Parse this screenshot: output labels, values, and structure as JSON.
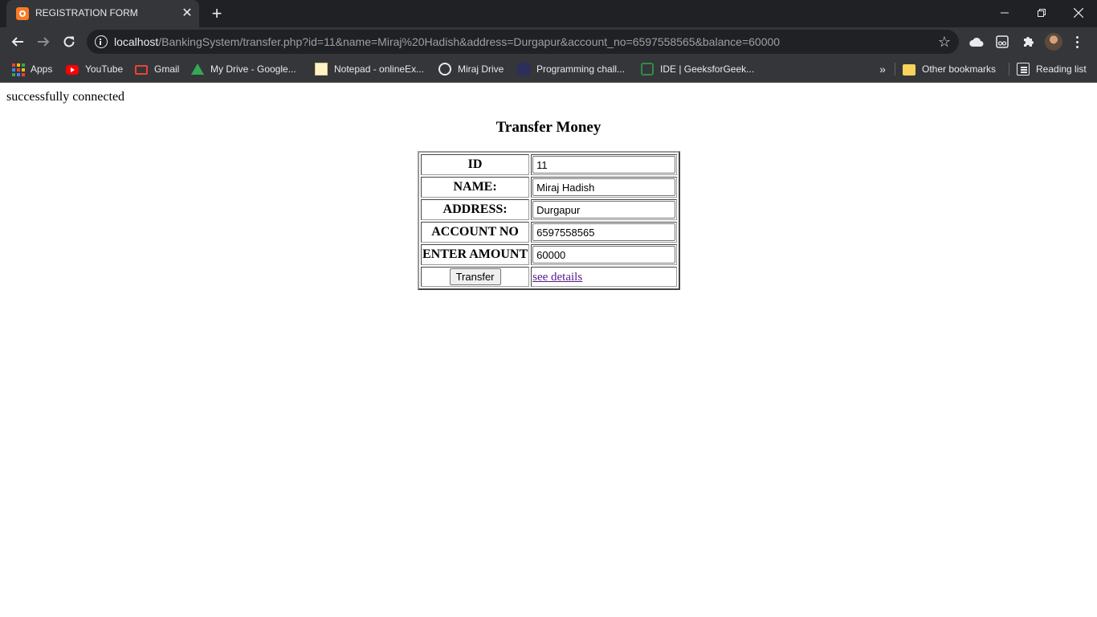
{
  "browser": {
    "tab": {
      "title": "REGISTRATION FORM"
    },
    "address_bar": {
      "host": "localhost",
      "path": "/BankingSystem/transfer.php?id=11&name=Miraj%20Hadish&address=Durgapur&account_no=6597558565&balance=60000"
    },
    "bookmarks": [
      {
        "label": "Apps",
        "icon": "apps-grid-icon"
      },
      {
        "label": "YouTube",
        "icon": "youtube-icon"
      },
      {
        "label": "Gmail",
        "icon": "gmail-icon"
      },
      {
        "label": "My Drive - Google...",
        "icon": "google-drive-icon"
      },
      {
        "label": "Notepad - onlineEx...",
        "icon": "notepad-icon"
      },
      {
        "label": "Miraj Drive",
        "icon": "globe-icon"
      },
      {
        "label": "Programming chall...",
        "icon": "bookmark-site-icon"
      },
      {
        "label": "IDE | GeeksforGeek...",
        "icon": "geeksforgeeks-icon"
      }
    ],
    "other_bookmarks": "Other bookmarks",
    "reading_list": "Reading list",
    "theme": {
      "frame": "#202124",
      "toolbar": "#35363a",
      "text": "#e8eaed"
    }
  },
  "page": {
    "status": "successfully connected",
    "heading": "Transfer Money",
    "form": {
      "rows": [
        {
          "label": "ID",
          "value": "11"
        },
        {
          "label": "NAME:",
          "value": "Miraj Hadish"
        },
        {
          "label": "ADDRESS:",
          "value": "Durgapur"
        },
        {
          "label": "ACCOUNT NO",
          "value": "6597558565"
        },
        {
          "label": "ENTER AMOUNT",
          "value": "60000"
        }
      ],
      "submit_label": "Transfer",
      "details_link": "see details"
    },
    "link_color": "#551a8b"
  }
}
